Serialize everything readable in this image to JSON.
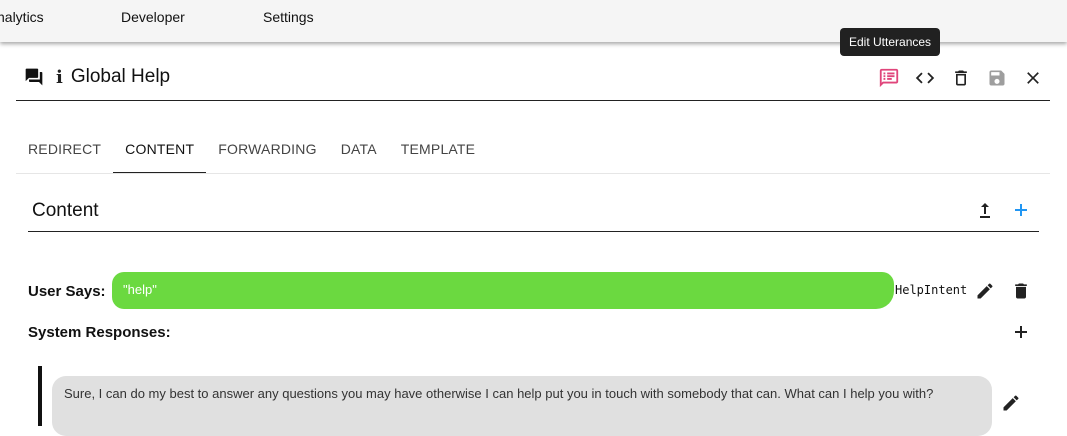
{
  "topnav": {
    "items": [
      "nalytics",
      "Developer",
      "Settings"
    ]
  },
  "tooltip": "Edit Utterances",
  "header": {
    "title": "Global Help",
    "info_glyph": "i",
    "icons": [
      "forum-icon",
      "edit-utterances-icon",
      "code-icon",
      "trash-icon",
      "save-icon",
      "close-icon"
    ],
    "accent_color": "#e0457b"
  },
  "tabs": [
    {
      "label": "REDIRECT",
      "active": false
    },
    {
      "label": "CONTENT",
      "active": true
    },
    {
      "label": "FORWARDING",
      "active": false
    },
    {
      "label": "DATA",
      "active": false
    },
    {
      "label": "TEMPLATE",
      "active": false
    }
  ],
  "content": {
    "title": "Content",
    "user_says_label": "User Says:",
    "utterance": "\"help\"",
    "utterance_color": "#6bd940",
    "intent": "HelpIntent",
    "system_responses_label": "System Responses:",
    "response_text": "Sure, I can do my best to answer any questions you may have otherwise I can help put you in touch with somebody that can. What can I help you with?",
    "add_color": "#2196f3"
  }
}
